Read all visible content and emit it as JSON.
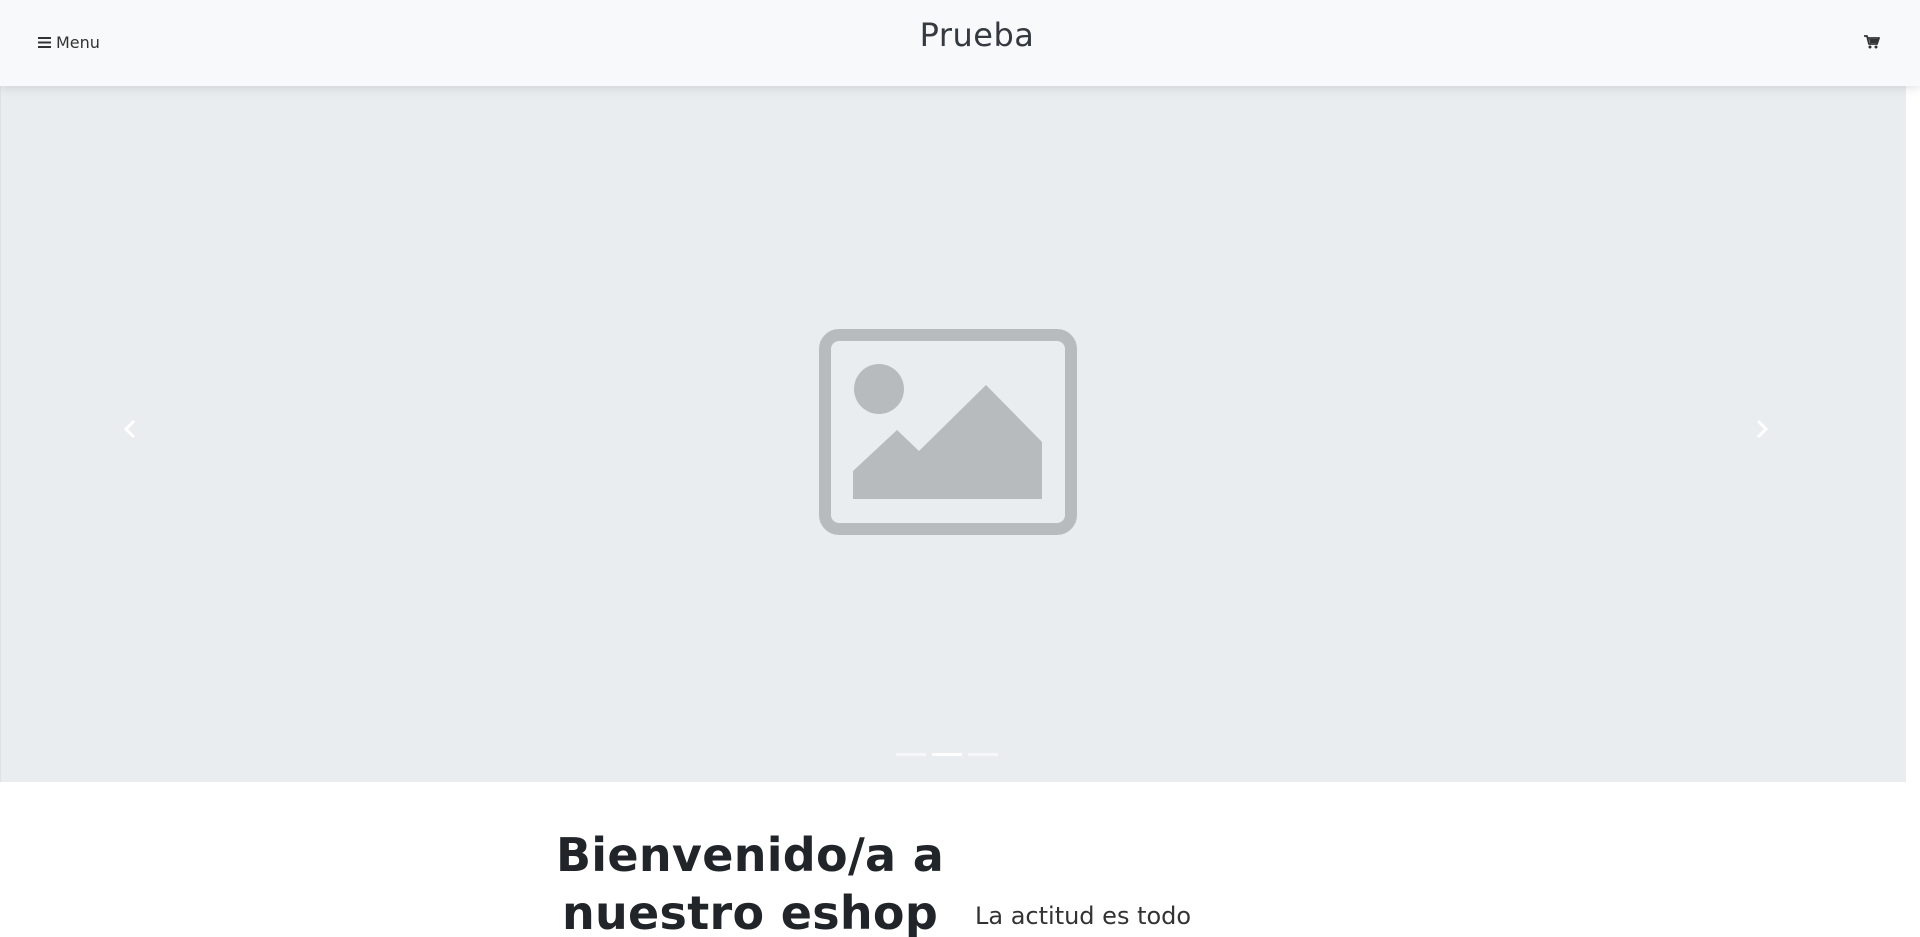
{
  "navbar": {
    "menu_label": "Menu",
    "menu_icon": "hamburger-icon",
    "brand": "Prueba",
    "cart_icon": "shopping-cart-icon"
  },
  "carousel": {
    "placeholder_icon": "image-placeholder-icon",
    "prev_icon": "chevron-left-icon",
    "next_icon": "chevron-right-icon",
    "slide_count": 3,
    "active_slide": 2,
    "background_color": "#e9edf0",
    "placeholder_color": "#b8bbbe"
  },
  "hero": {
    "title_line1": "Bienvenido/a a",
    "title_line2": "nuestro eshop",
    "tagline": "La actitud es todo"
  }
}
